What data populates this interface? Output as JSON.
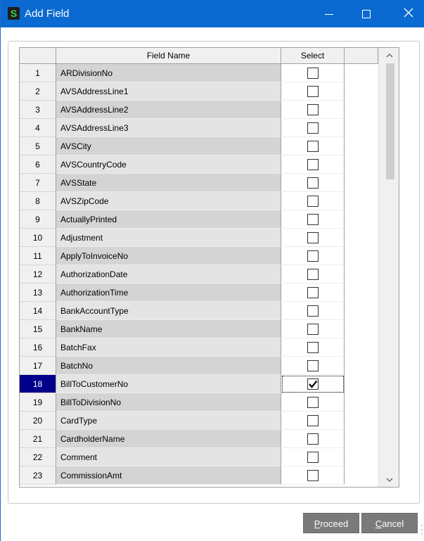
{
  "window": {
    "title": "Add Field",
    "app_icon_letter": "S",
    "controls": {
      "minimize": "minimize-icon",
      "maximize": "maximize-icon",
      "close": "close-icon"
    }
  },
  "grid": {
    "columns": {
      "row_number": "",
      "field_name": "Field Name",
      "select": "Select"
    },
    "active_row": 18,
    "rows": [
      {
        "num": "1",
        "name": "ARDivisionNo",
        "checked": false
      },
      {
        "num": "2",
        "name": "AVSAddressLine1",
        "checked": false
      },
      {
        "num": "3",
        "name": "AVSAddressLine2",
        "checked": false
      },
      {
        "num": "4",
        "name": "AVSAddressLine3",
        "checked": false
      },
      {
        "num": "5",
        "name": "AVSCity",
        "checked": false
      },
      {
        "num": "6",
        "name": "AVSCountryCode",
        "checked": false
      },
      {
        "num": "7",
        "name": "AVSState",
        "checked": false
      },
      {
        "num": "8",
        "name": "AVSZipCode",
        "checked": false
      },
      {
        "num": "9",
        "name": "ActuallyPrinted",
        "checked": false
      },
      {
        "num": "10",
        "name": "Adjustment",
        "checked": false
      },
      {
        "num": "11",
        "name": "ApplyToInvoiceNo",
        "checked": false
      },
      {
        "num": "12",
        "name": "AuthorizationDate",
        "checked": false
      },
      {
        "num": "13",
        "name": "AuthorizationTime",
        "checked": false
      },
      {
        "num": "14",
        "name": "BankAccountType",
        "checked": false
      },
      {
        "num": "15",
        "name": "BankName",
        "checked": false
      },
      {
        "num": "16",
        "name": "BatchFax",
        "checked": false
      },
      {
        "num": "17",
        "name": "BatchNo",
        "checked": false
      },
      {
        "num": "18",
        "name": "BillToCustomerNo",
        "checked": true
      },
      {
        "num": "19",
        "name": "BillToDivisionNo",
        "checked": false
      },
      {
        "num": "20",
        "name": "CardType",
        "checked": false
      },
      {
        "num": "21",
        "name": "CardholderName",
        "checked": false
      },
      {
        "num": "22",
        "name": "Comment",
        "checked": false
      },
      {
        "num": "23",
        "name": "CommissionAmt",
        "checked": false
      }
    ],
    "scrollbar": {
      "up_icon": "chevron-up-icon",
      "down_icon": "chevron-down-icon",
      "up_glyph": "^",
      "down_glyph": "v"
    }
  },
  "buttons": {
    "proceed_mnemonic": "P",
    "proceed_rest": "roceed",
    "cancel_mnemonic": "C",
    "cancel_rest": "ancel"
  },
  "colors": {
    "titlebar": "#0a6ad1",
    "active_row_number": "#00008b",
    "button": "#7a7a7a"
  }
}
